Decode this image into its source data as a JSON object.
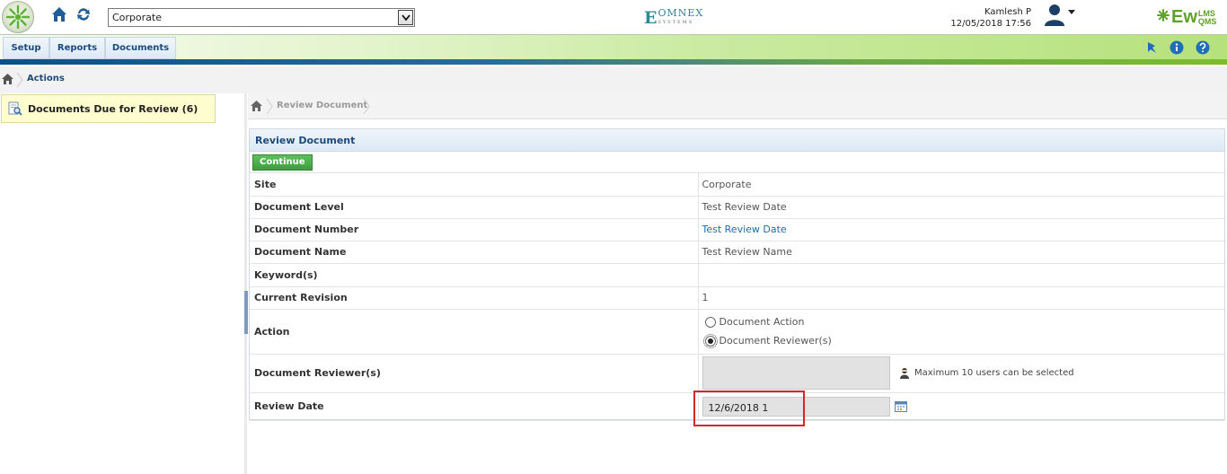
{
  "header": {
    "site_selected": "Corporate",
    "omnex_brand": "OMNEX",
    "omnex_sub": "SYSTEMS",
    "user_name": "Kamlesh P",
    "datetime": "12/05/2018 17:56",
    "ew_brand": "Ew",
    "ew_top": "LMS",
    "ew_bottom": "QMS"
  },
  "nav": {
    "tabs": [
      "Setup",
      "Reports",
      "Documents"
    ]
  },
  "breadcrumb": {
    "current": "Actions"
  },
  "sidebar": {
    "item_label": "Documents Due for Review (6)"
  },
  "inner_breadcrumb": {
    "current": "Review Document"
  },
  "panel": {
    "title": "Review Document",
    "continue_label": "Continue",
    "rows": {
      "site": {
        "label": "Site",
        "value": "Corporate"
      },
      "level": {
        "label": "Document Level",
        "value": "Test Review Date"
      },
      "number": {
        "label": "Document Number",
        "value": "Test Review Date"
      },
      "name": {
        "label": "Document Name",
        "value": "Test Review Name"
      },
      "keywords": {
        "label": "Keyword(s)",
        "value": ""
      },
      "revision": {
        "label": "Current Revision",
        "value": "1"
      },
      "action": {
        "label": "Action",
        "option1": "Document Action",
        "option2": "Document Reviewer(s)",
        "selected": "Document Reviewer(s)"
      },
      "reviewers": {
        "label": "Document Reviewer(s)",
        "hint": "Maximum 10 users can be selected"
      },
      "review_date": {
        "label": "Review Date",
        "value": "12/6/2018 1"
      }
    }
  },
  "colors": {
    "accent": "#1c4a7a",
    "continue": "#3e9d3e",
    "highlight": "#d9252a",
    "link": "#1a6fa8"
  }
}
